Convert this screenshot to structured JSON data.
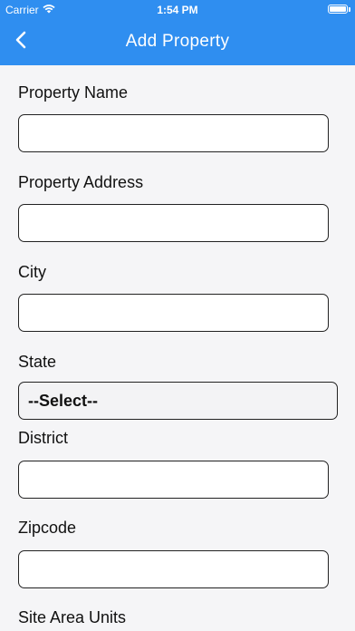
{
  "status_bar": {
    "carrier": "Carrier",
    "time": "1:54 PM",
    "wifi_icon": "wifi-icon",
    "battery_icon": "battery-icon"
  },
  "header": {
    "title": "Add Property",
    "back_icon": "chevron-left-icon",
    "background_color": "#2f8ef0"
  },
  "form": {
    "property_name": {
      "label": "Property Name",
      "value": "",
      "placeholder": ""
    },
    "property_address": {
      "label": "Property Address",
      "value": "",
      "placeholder": ""
    },
    "city": {
      "label": "City",
      "value": "",
      "placeholder": ""
    },
    "state": {
      "label": "State",
      "selected": "--Select--"
    },
    "district": {
      "label": "District",
      "value": "",
      "placeholder": ""
    },
    "zipcode": {
      "label": "Zipcode",
      "value": "",
      "placeholder": ""
    },
    "site_area_units": {
      "label": "Site Area Units"
    }
  }
}
